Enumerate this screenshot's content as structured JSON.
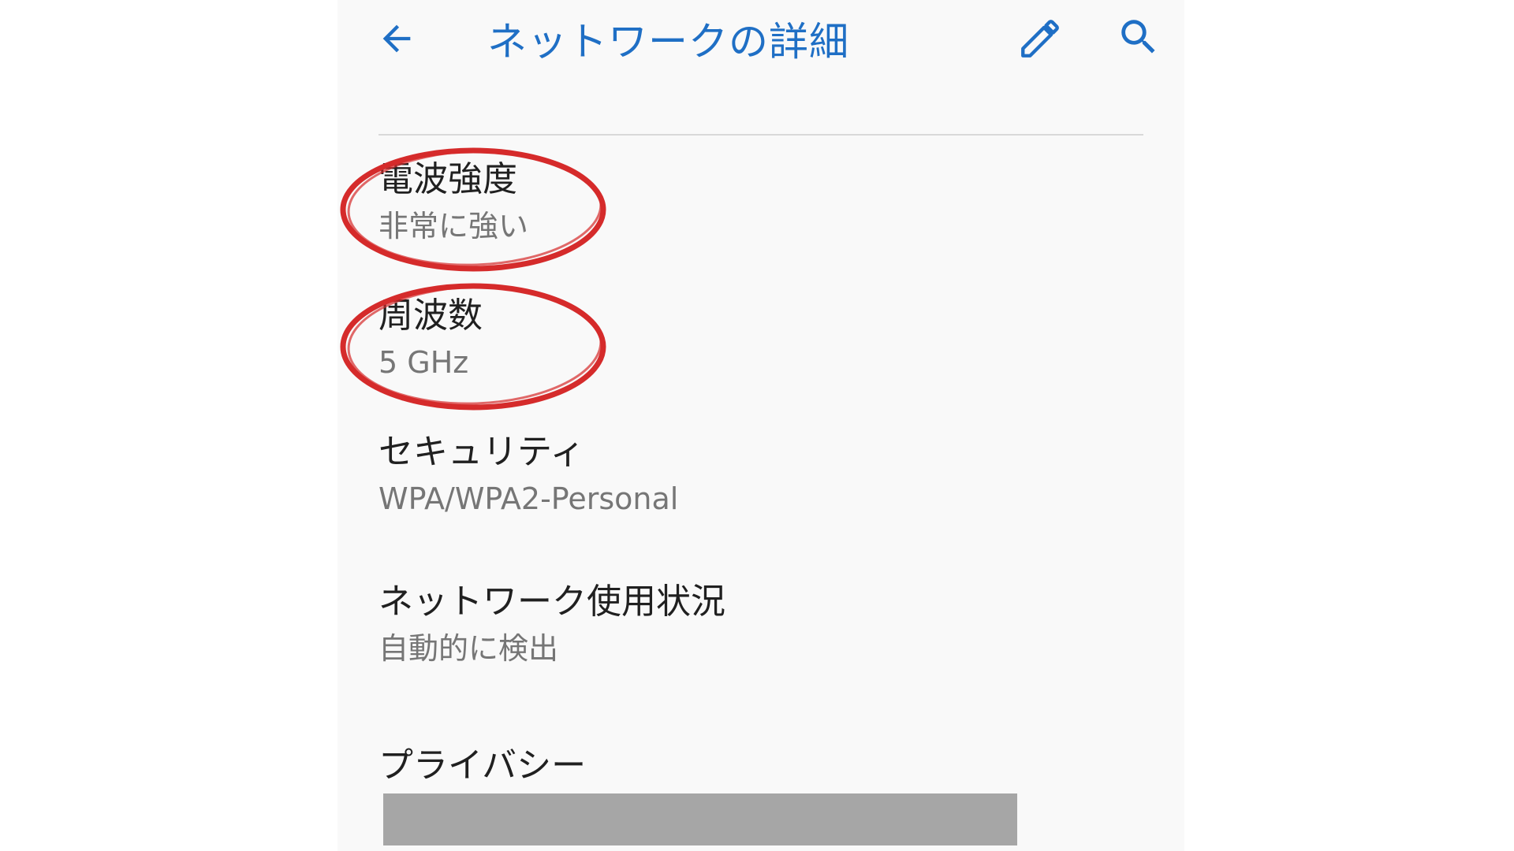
{
  "header": {
    "title": "ネットワークの詳細",
    "back_icon": "arrow-left-icon",
    "edit_icon": "pencil-icon",
    "search_icon": "search-icon"
  },
  "details": [
    {
      "title": "電波強度",
      "value": "非常に強い"
    },
    {
      "title": "周波数",
      "value": "5 GHz"
    },
    {
      "title": "セキュリティ",
      "value": "WPA/WPA2-Personal"
    },
    {
      "title": "ネットワーク使用状況",
      "value": "自動的に検出"
    },
    {
      "title": "プライバシー"
    }
  ],
  "colors": {
    "accent": "#1f6fc5",
    "annotation_circle": "#d52b2b",
    "redaction_bar": "#a6a6a6"
  }
}
